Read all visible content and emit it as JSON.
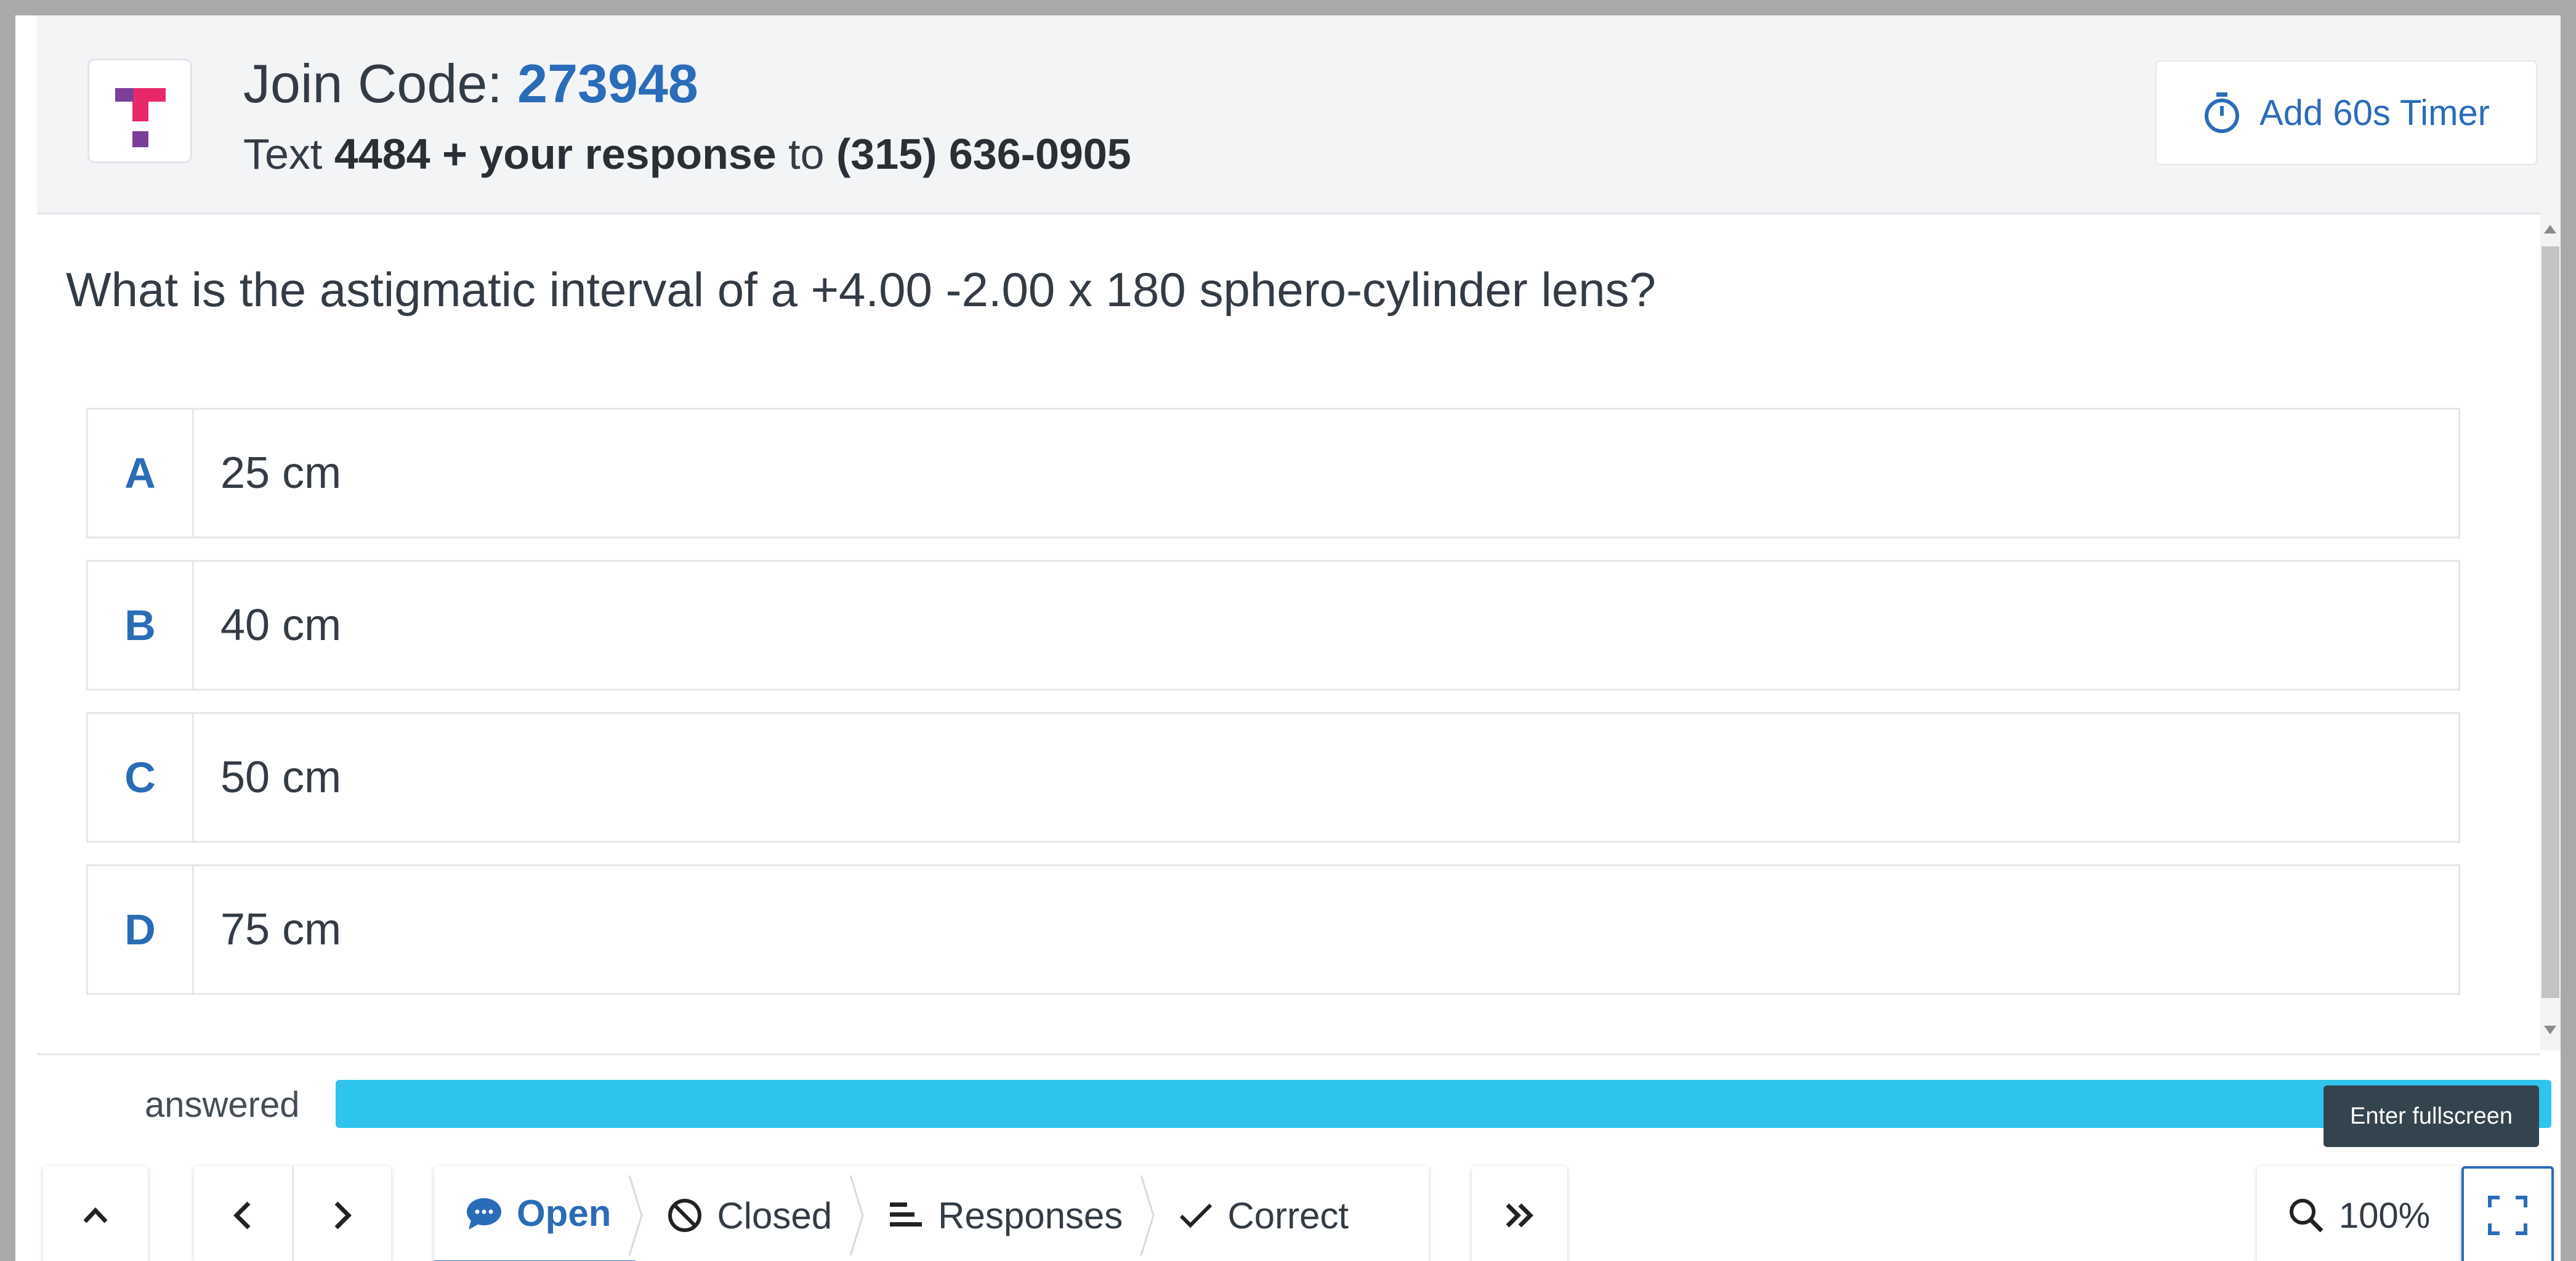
{
  "header": {
    "join_label": "Join Code: ",
    "join_code": "273948",
    "text_prefix": "Text ",
    "text_bold": "4484 + your response",
    "text_mid": " to ",
    "phone": "(315) 636-0905",
    "timer_label": "Add 60s Timer"
  },
  "question": "What is the astigmatic interval of a +4.00 -2.00 x 180 sphero-cylinder lens?",
  "options": [
    {
      "letter": "A",
      "text": "25 cm"
    },
    {
      "letter": "B",
      "text": "40 cm"
    },
    {
      "letter": "C",
      "text": "50 cm"
    },
    {
      "letter": "D",
      "text": "75 cm"
    }
  ],
  "progress": {
    "label": "answered",
    "fraction": 1.0
  },
  "tooltip": "Enter fullscreen",
  "toolbar": {
    "open": "Open",
    "closed": "Closed",
    "responses": "Responses",
    "correct": "Correct",
    "zoom": "100%"
  },
  "colors": {
    "accent": "#2b6cb8",
    "progress": "#2ec4ec",
    "logo_pink": "#e7296a",
    "logo_purple": "#7b3f98"
  },
  "icons": [
    "stopwatch-icon",
    "chevron-up-icon",
    "chevron-left-icon",
    "chevron-right-icon",
    "chat-bubble-icon",
    "no-entry-icon",
    "bars-icon",
    "check-icon",
    "double-chevron-right-icon",
    "search-icon",
    "fullscreen-icon"
  ]
}
